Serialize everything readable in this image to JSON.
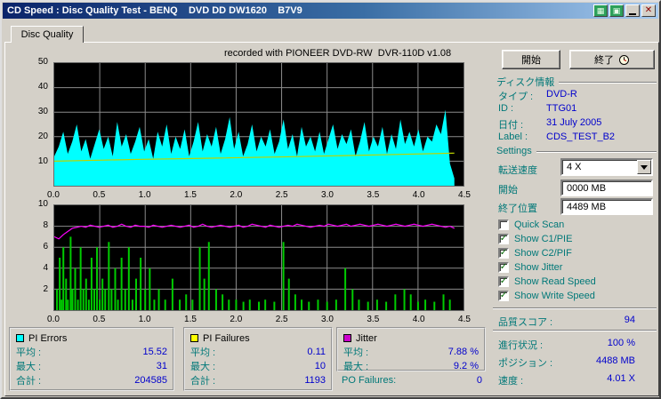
{
  "window": {
    "title": "CD Speed : Disc Quality Test - BENQ    DVD DD DW1620    B7V9"
  },
  "icons": {
    "extra1": "▦",
    "extra2": "▣",
    "close": "✕"
  },
  "tabs": [
    {
      "label": "Disc Quality"
    }
  ],
  "chart_header": "recorded with PIONEER DVD-RW  DVR-110D v1.08",
  "controls": {
    "start_button": "開始",
    "exit_button": "終了"
  },
  "disc_info": {
    "header": "ディスク情報",
    "rows": [
      {
        "label": "タイプ :",
        "value": "DVD-R"
      },
      {
        "label": "ID :",
        "value": "TTG01"
      },
      {
        "label": "日付 :",
        "value": "31 July 2005"
      },
      {
        "label": "Label :",
        "value": "CDS_TEST_B2"
      }
    ]
  },
  "settings": {
    "header": "Settings",
    "speed_label": "転送速度",
    "speed_value": "4 X",
    "start_label": "開始",
    "start_value": "0000 MB",
    "end_label": "終了位置",
    "end_value": "4489 MB",
    "checkboxes": [
      {
        "label": "Quick Scan",
        "checked": false
      },
      {
        "label": "Show C1/PIE",
        "checked": true
      },
      {
        "label": "Show C2/PIF",
        "checked": true
      },
      {
        "label": "Show Jitter",
        "checked": true
      },
      {
        "label": "Show Read Speed",
        "checked": true
      },
      {
        "label": "Show Write Speed",
        "checked": true
      }
    ]
  },
  "score": {
    "label": "品質スコア :",
    "value": "94"
  },
  "status": {
    "progress_label": "進行状況 :",
    "progress_value": "100 %",
    "position_label": "ポジション :",
    "position_value": "4488 MB",
    "speed_label": "速度 :",
    "speed_value": "4.01 X"
  },
  "stats": {
    "pi_errors": {
      "title": "PI Errors",
      "color": "#00ffff",
      "avg_label": "平均 :",
      "avg": "15.52",
      "max_label": "最大 :",
      "max": "31",
      "total_label": "合計 :",
      "total": "204585"
    },
    "pi_failures": {
      "title": "PI Failures",
      "color": "#ffff00",
      "avg_label": "平均 :",
      "avg": "0.11",
      "max_label": "最大 :",
      "max": "10",
      "total_label": "合計 :",
      "total": "1193"
    },
    "jitter": {
      "title": "Jitter",
      "color": "#cc00cc",
      "avg_label": "平均 :",
      "avg": "7.88 %",
      "max_label": "最大 :",
      "max": "9.2 %"
    },
    "po_failures": {
      "label": "PO Failures:",
      "value": "0"
    }
  },
  "chart_data": [
    {
      "type": "area",
      "title": "PI Errors (C1/PIE) vs position (GB)",
      "xlim": [
        0,
        4.5
      ],
      "ylim": [
        0,
        50
      ],
      "x_ticks": [
        "0.0",
        "0.5",
        "1.0",
        "1.5",
        "2.0",
        "2.5",
        "3.0",
        "3.5",
        "4.0",
        "4.5"
      ],
      "y_ticks": [
        50,
        40,
        30,
        20,
        10
      ],
      "x_start": 0,
      "x_end": 4.4,
      "grid": true,
      "series": [
        {
          "name": "pi-errors",
          "color": "#00ffff",
          "fill": true,
          "values": [
            12,
            16,
            22,
            13,
            18,
            25,
            14,
            19,
            11,
            17,
            23,
            15,
            20,
            12,
            26,
            16,
            21,
            13,
            18,
            24,
            14,
            19,
            11,
            22,
            16,
            25,
            13,
            20,
            15,
            23,
            12,
            18,
            26,
            14,
            21,
            16,
            24,
            13,
            19,
            28,
            15,
            22,
            12,
            17,
            25,
            14,
            20,
            16,
            23,
            13,
            18,
            27,
            15,
            21,
            12,
            24,
            16,
            20,
            14,
            22,
            13,
            19,
            25,
            15,
            21,
            17,
            23,
            12,
            18,
            26,
            14,
            20,
            16,
            24,
            13,
            21,
            15,
            27,
            17,
            22,
            16,
            23,
            14,
            20,
            18,
            25,
            21,
            31,
            9,
            3
          ]
        },
        {
          "name": "write-speed",
          "color": "#bcd400",
          "points": [
            [
              0,
              10
            ],
            [
              0.9,
              10.7
            ],
            [
              1.8,
              11.3
            ],
            [
              2.7,
              11.9
            ],
            [
              3.6,
              12.6
            ],
            [
              4.4,
              13.3
            ]
          ]
        }
      ]
    },
    {
      "type": "line+bar",
      "title": "PI Failures (green) and Jitter (magenta) vs position (GB)",
      "xlim": [
        0,
        4.5
      ],
      "ylim": [
        0,
        10
      ],
      "x_ticks": [
        "0.0",
        "0.5",
        "1.0",
        "1.5",
        "2.0",
        "2.5",
        "3.0",
        "3.5",
        "4.0",
        "4.5"
      ],
      "y_ticks": [
        10,
        8,
        6,
        4,
        2
      ],
      "x_start": 0,
      "x_end": 4.4,
      "grid": true,
      "bar_color": "#00cc00",
      "bars": [
        [
          0.03,
          2
        ],
        [
          0.06,
          5
        ],
        [
          0.08,
          1
        ],
        [
          0.1,
          6
        ],
        [
          0.13,
          3
        ],
        [
          0.15,
          1
        ],
        [
          0.18,
          7
        ],
        [
          0.2,
          2
        ],
        [
          0.23,
          4
        ],
        [
          0.26,
          1
        ],
        [
          0.29,
          6
        ],
        [
          0.32,
          2
        ],
        [
          0.35,
          3
        ],
        [
          0.38,
          1
        ],
        [
          0.41,
          5
        ],
        [
          0.44,
          2
        ],
        [
          0.47,
          6
        ],
        [
          0.5,
          1
        ],
        [
          0.53,
          3
        ],
        [
          0.56,
          2
        ],
        [
          0.6,
          6.5
        ],
        [
          0.63,
          2
        ],
        [
          0.67,
          4
        ],
        [
          0.7,
          1
        ],
        [
          0.74,
          5
        ],
        [
          0.78,
          2
        ],
        [
          0.82,
          6
        ],
        [
          0.86,
          1
        ],
        [
          0.9,
          3
        ],
        [
          0.95,
          5
        ],
        [
          1.0,
          2
        ],
        [
          1.05,
          4
        ],
        [
          1.1,
          1
        ],
        [
          1.15,
          2
        ],
        [
          1.22,
          1
        ],
        [
          1.3,
          3
        ],
        [
          1.38,
          1
        ],
        [
          1.45,
          1.5
        ],
        [
          1.52,
          1
        ],
        [
          1.6,
          6
        ],
        [
          1.65,
          3
        ],
        [
          1.7,
          6.5
        ],
        [
          1.78,
          2
        ],
        [
          1.85,
          1.5
        ],
        [
          1.92,
          1
        ],
        [
          2.0,
          1
        ],
        [
          2.08,
          0.8
        ],
        [
          2.15,
          1
        ],
        [
          2.25,
          0.8
        ],
        [
          2.32,
          1
        ],
        [
          2.42,
          0.8
        ],
        [
          2.52,
          6.5
        ],
        [
          2.58,
          3
        ],
        [
          2.65,
          1.5
        ],
        [
          2.72,
          1
        ],
        [
          2.8,
          0.8
        ],
        [
          2.9,
          1
        ],
        [
          3.0,
          0.8
        ],
        [
          3.1,
          1
        ],
        [
          3.2,
          4
        ],
        [
          3.28,
          2
        ],
        [
          3.35,
          1
        ],
        [
          3.45,
          0.8
        ],
        [
          3.55,
          1
        ],
        [
          3.65,
          0.8
        ],
        [
          3.75,
          1.5
        ],
        [
          3.85,
          2
        ],
        [
          3.92,
          1.5
        ],
        [
          4.0,
          0.8
        ],
        [
          4.08,
          1
        ],
        [
          4.18,
          0.8
        ],
        [
          4.28,
          1.5
        ],
        [
          4.35,
          1
        ]
      ],
      "series": [
        {
          "name": "jitter",
          "color": "#ff00ff",
          "values": [
            7.0,
            6.8,
            7.2,
            7.5,
            7.8,
            7.9,
            8.0,
            7.9,
            8.1,
            8.0,
            7.9,
            8.0,
            8.1,
            7.9,
            8.0,
            8.2,
            8.0,
            7.9,
            8.1,
            8.0,
            8.0,
            7.9,
            8.1,
            8.0,
            7.9,
            8.0,
            8.1,
            8.0,
            7.9,
            8.0,
            8.1,
            7.9,
            8.0,
            8.2,
            8.0,
            7.9,
            8.0,
            8.1,
            8.0,
            7.9,
            8.0,
            8.1,
            7.9,
            8.0,
            8.2,
            8.1,
            8.0,
            7.9,
            8.1,
            8.0,
            7.9,
            8.0,
            8.1,
            8.0,
            8.2,
            8.1,
            8.0,
            7.9,
            8.0,
            8.1,
            8.0,
            8.2,
            8.1,
            8.0,
            8.1,
            8.2,
            8.0,
            8.1,
            8.2,
            8.1,
            8.0,
            8.1,
            8.2,
            8.1,
            8.0,
            8.1,
            8.2,
            8.1,
            8.0,
            8.1,
            8.2,
            8.1,
            8.0,
            8.1,
            8.2,
            8.1,
            8.0,
            7.9,
            8.0,
            7.8
          ]
        }
      ]
    }
  ]
}
